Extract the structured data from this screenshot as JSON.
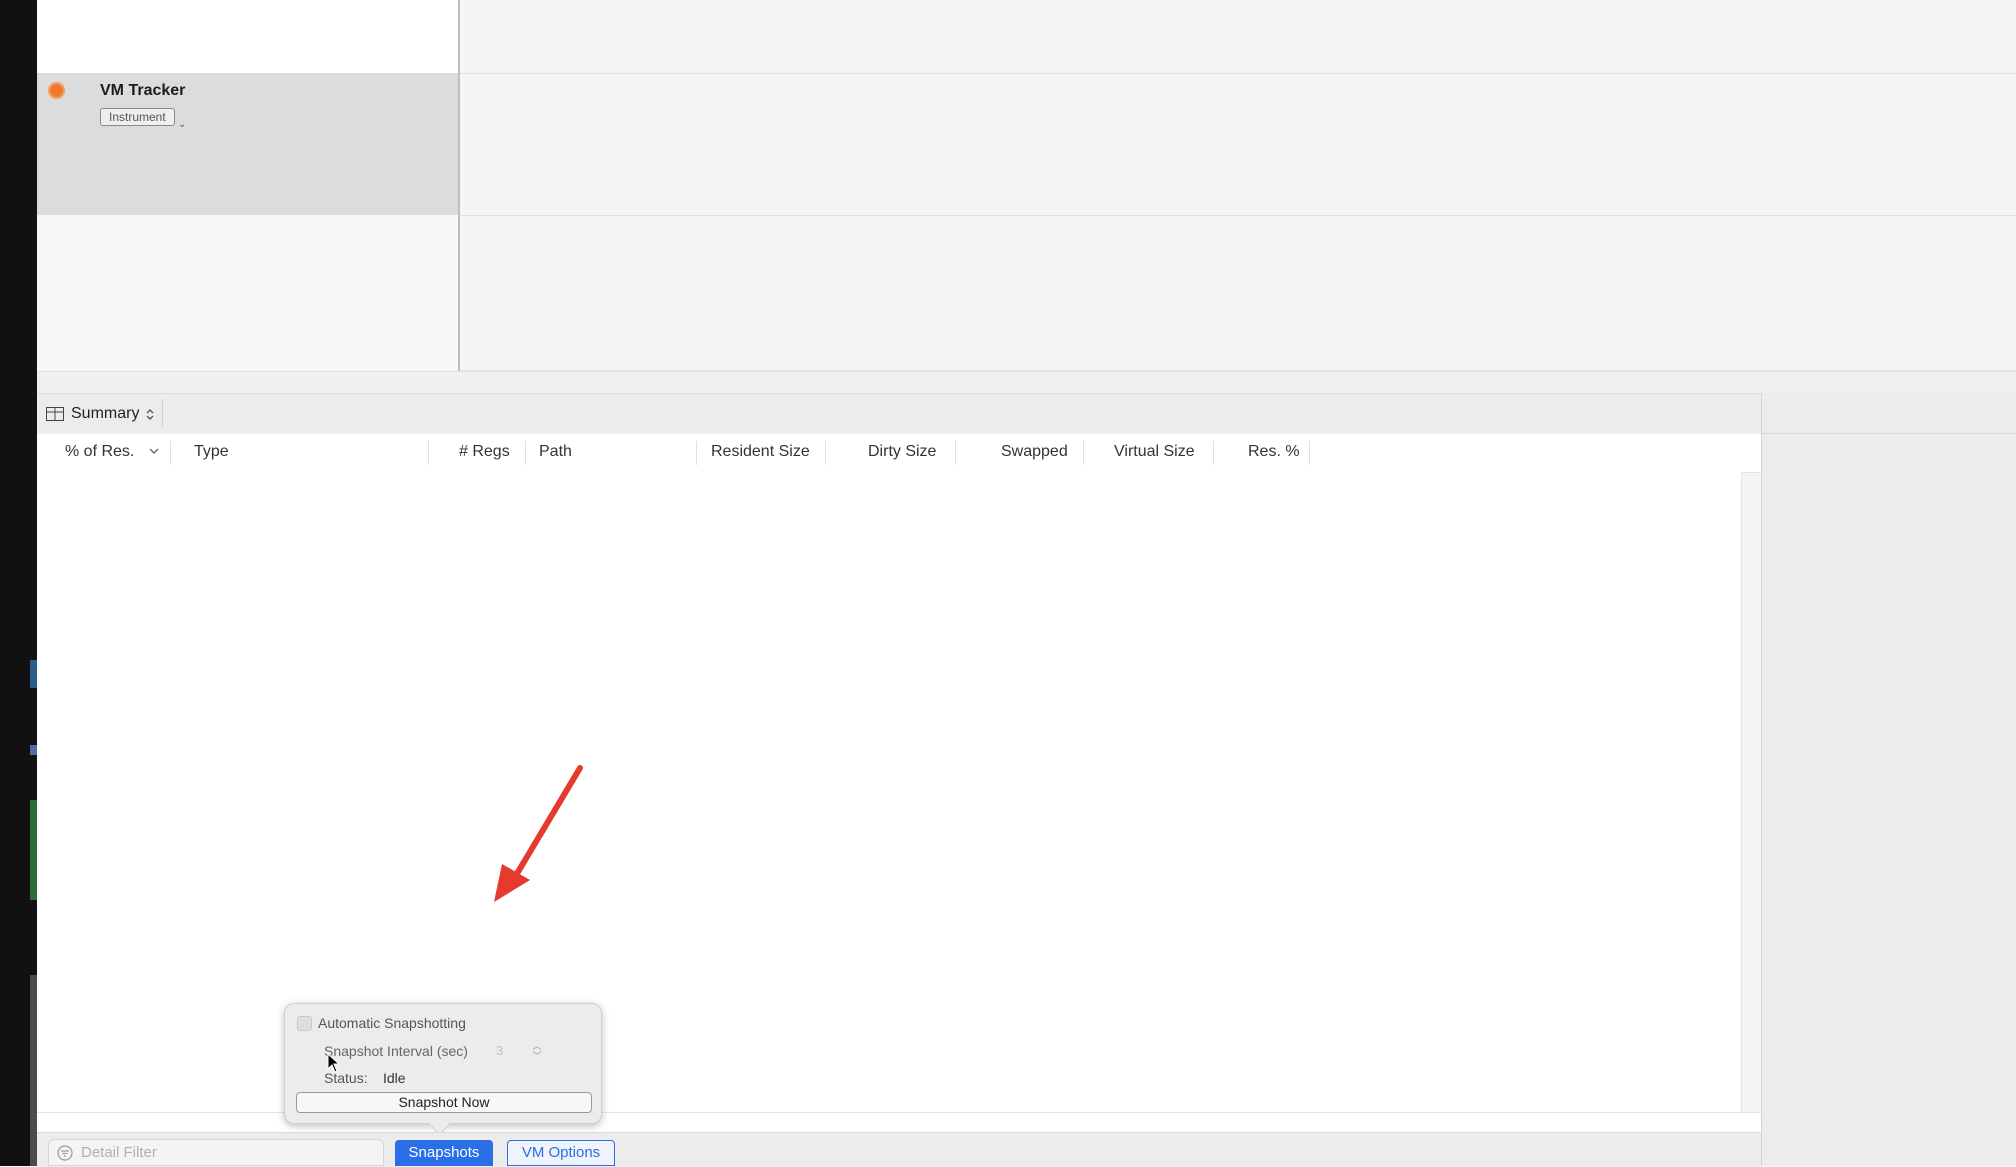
{
  "track": {
    "name": "VM Tracker",
    "badge": "Instrument",
    "icon": "vm-tracker-instrument-icon"
  },
  "detail": {
    "view_label": "Summary",
    "columns": [
      "% of Res.",
      "Type",
      "# Regs",
      "Path",
      "Resident Size",
      "Dirty Size",
      "Swapped",
      "Virtual Size",
      "Res. %"
    ],
    "sort_column": "% of Res.",
    "sort_direction": "descending",
    "rows": []
  },
  "bottom_bar": {
    "filter_placeholder": "Detail Filter",
    "snapshots_tab": "Snapshots",
    "vm_options_tab": "VM Options"
  },
  "popover": {
    "auto_snapshot_label": "Automatic Snapshotting",
    "auto_snapshot_checked": false,
    "interval_label": "Snapshot Interval (sec)",
    "interval_value": "3",
    "status_label": "Status:",
    "status_value": "Idle",
    "snapshot_now_label": "Snapshot Now"
  },
  "colors": {
    "accent_blue": "#2a6ee8",
    "instrument_orange": "#f07a2c",
    "annotation_red": "#e53a2e"
  }
}
